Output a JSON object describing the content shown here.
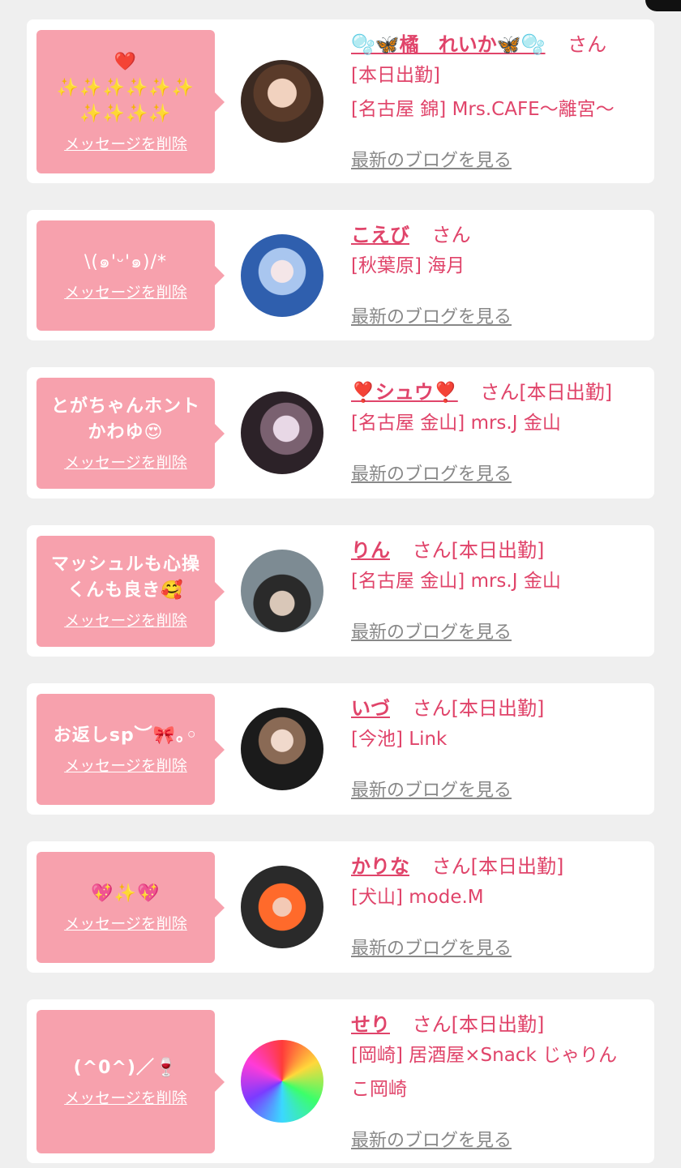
{
  "common": {
    "delete_label": "メッセージを削除",
    "blog_label": "最新のブログを見る",
    "san": "さん"
  },
  "cards": [
    {
      "message": "❤️\n✨✨✨✨✨✨\n✨✨✨✨",
      "name": "🫧🦋橘　れいか🦋🫧",
      "attendance": "",
      "line2": "[本日出勤]",
      "line3": "[名古屋 錦] Mrs.CAFE〜離宮〜"
    },
    {
      "message": "\\(๑'ᵕ'๑)/*",
      "name": "こえび",
      "attendance": "",
      "line2": "[秋葉原] 海月",
      "line3": ""
    },
    {
      "message": "とがちゃんホント\nかわゆ😍",
      "name": "❣️シュウ❣️",
      "attendance": "[本日出勤]",
      "line2": "[名古屋 金山] mrs.J 金山",
      "line3": ""
    },
    {
      "message": "マッシュルも心操\nくんも良き🥰",
      "name": "りん",
      "attendance": "[本日出勤]",
      "line2": "[名古屋 金山] mrs.J 金山",
      "line3": ""
    },
    {
      "message": "お返しsp︶🎀｡◦",
      "name": "いづ",
      "attendance": "[本日出勤]",
      "line2": "[今池] Link",
      "line3": ""
    },
    {
      "message": "💖✨💖",
      "name": "かりな",
      "attendance": "[本日出勤]",
      "line2": "[犬山] mode.M",
      "line3": ""
    },
    {
      "message": "(^0^)／🍷",
      "name": "せり",
      "attendance": "[本日出勤]",
      "line2": "[岡崎] 居酒屋×Snack じゃりん",
      "line3": "こ岡崎"
    }
  ],
  "colors": {
    "accent": "#e0446a",
    "bubble": "#f7a1ad",
    "background": "#efefef"
  }
}
